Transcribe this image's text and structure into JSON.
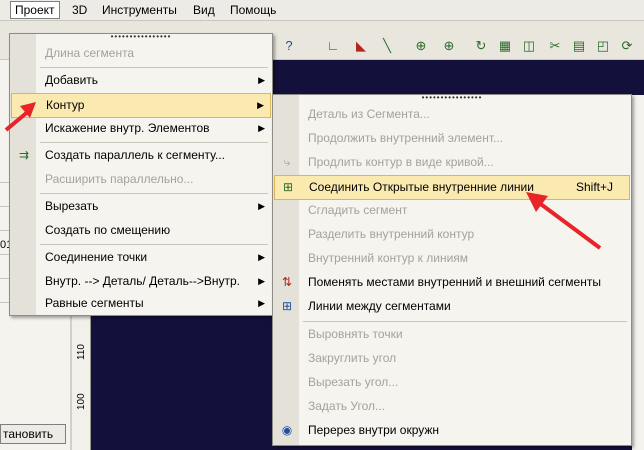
{
  "menubar": {
    "items": [
      {
        "label": "Проект",
        "active": true
      },
      {
        "label": "3D",
        "active": false
      },
      {
        "label": "Инструменты",
        "active": false
      },
      {
        "label": "Вид",
        "active": false
      },
      {
        "label": "Помощь",
        "active": false
      }
    ]
  },
  "left_panel": {
    "cell_value": "01",
    "restore_button": "тановить"
  },
  "ruler": {
    "ticks": [
      "110",
      "100"
    ]
  },
  "main_menu": {
    "items": [
      {
        "label": "Длина сегмента",
        "disabled": true,
        "submenu": false
      },
      {
        "label": "Добавить",
        "disabled": false,
        "submenu": true
      },
      {
        "label": "Контур",
        "disabled": false,
        "submenu": true,
        "highlighted": true
      },
      {
        "label": "Искажение внутр. Элементов",
        "disabled": false,
        "submenu": true
      },
      {
        "label": "Создать параллель к сегменту...",
        "disabled": false,
        "submenu": false,
        "icon": true
      },
      {
        "label": "Расширить параллельно...",
        "disabled": true,
        "submenu": false
      },
      {
        "label": "Вырезать",
        "disabled": false,
        "submenu": true
      },
      {
        "label": "Создать по смещению",
        "disabled": false,
        "submenu": false
      },
      {
        "label": "Соединение точки",
        "disabled": false,
        "submenu": true
      },
      {
        "label": "Внутр. --> Деталь/ Деталь-->Внутр.",
        "disabled": false,
        "submenu": true
      },
      {
        "label": "Равные сегменты",
        "disabled": false,
        "submenu": true
      }
    ]
  },
  "contour_menu": {
    "items": [
      {
        "label": "Деталь из Сегмента...",
        "disabled": true
      },
      {
        "label": "Продолжить внутренний элемент...",
        "disabled": true
      },
      {
        "label": "Продлить контур в виде кривой...",
        "disabled": true,
        "icon": true
      },
      {
        "label": "Соединить Открытые внутренние линии",
        "shortcut": "Shift+J",
        "disabled": false,
        "highlighted": true,
        "icon": true
      },
      {
        "label": "Сгладить сегмент",
        "disabled": true
      },
      {
        "label": "Разделить внутренний контур",
        "disabled": true
      },
      {
        "label": "Внутренний контур к линиям",
        "disabled": true
      },
      {
        "label": "Поменять местами внутренний и внешний сегменты",
        "disabled": false,
        "icon": true
      },
      {
        "label": "Линии между сегментами",
        "disabled": false,
        "icon": true
      },
      {
        "label": "Выровнять точки",
        "disabled": true
      },
      {
        "label": "Закруглить угол",
        "disabled": true
      },
      {
        "label": "Вырезать угол...",
        "disabled": true
      },
      {
        "label": "Задать Угол...",
        "disabled": true
      },
      {
        "label": "Перерез внутри окружн",
        "disabled": false,
        "icon": true
      }
    ]
  },
  "colors": {
    "highlight": "#fbeab0",
    "canvas": "#13103b",
    "annotation_arrow": "#e8232a"
  }
}
